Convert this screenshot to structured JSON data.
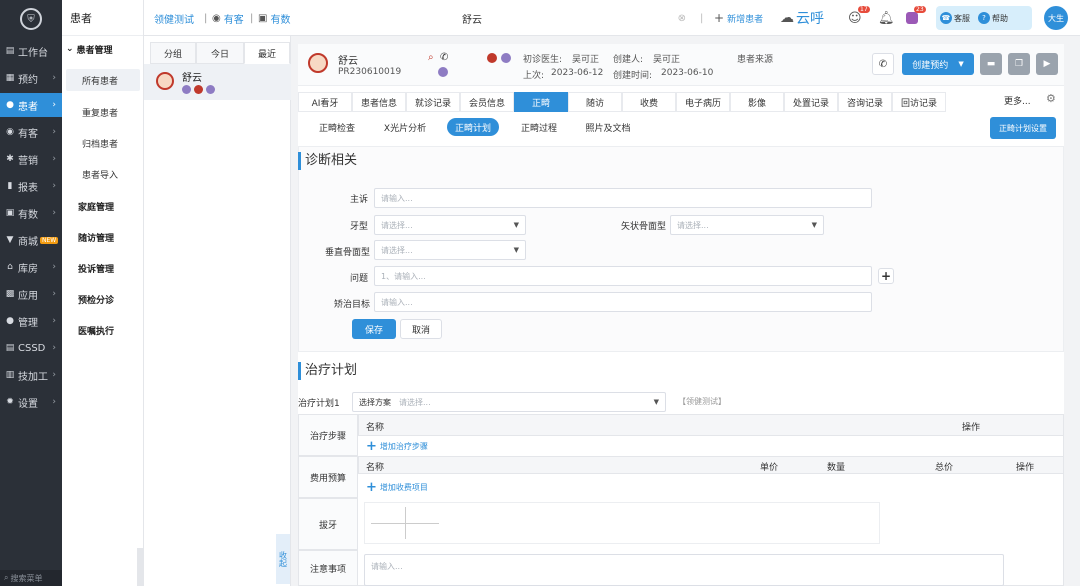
{
  "colors": {
    "accent": "#2f8fd9",
    "nav_bg": "#2b3038"
  },
  "nav": {
    "logo_icon": "tooth-shield-icon",
    "items": [
      {
        "label": "工作台",
        "icon": "dashboard-icon"
      },
      {
        "label": "预约",
        "icon": "calendar-icon"
      },
      {
        "label": "患者",
        "icon": "user-icon"
      },
      {
        "label": "有客",
        "icon": "eye-icon"
      },
      {
        "label": "营销",
        "icon": "gift-icon"
      },
      {
        "label": "报表",
        "icon": "chart-icon"
      },
      {
        "label": "有数",
        "icon": "data-icon"
      },
      {
        "label": "商城",
        "icon": "cart-icon",
        "badge": "NEW"
      },
      {
        "label": "库房",
        "icon": "warehouse-icon"
      },
      {
        "label": "应用",
        "icon": "apps-icon"
      },
      {
        "label": "管理",
        "icon": "manage-icon"
      },
      {
        "label": "CSSD",
        "icon": "cssd-icon"
      },
      {
        "label": "技加工",
        "icon": "tool-icon"
      },
      {
        "label": "设置",
        "icon": "gear-icon"
      }
    ],
    "bottom": "搜索菜单"
  },
  "submenu": {
    "title": "患者",
    "items": [
      {
        "label": "患者管理",
        "group": true
      },
      {
        "label": "所有患者"
      },
      {
        "label": "重复患者"
      },
      {
        "label": "归档患者"
      },
      {
        "label": "患者导入"
      },
      {
        "label": "家庭管理",
        "group": true
      },
      {
        "label": "随访管理",
        "group": true
      },
      {
        "label": "投诉管理",
        "group": true
      },
      {
        "label": "预检分诊",
        "group": true
      },
      {
        "label": "医嘱执行",
        "group": true
      }
    ]
  },
  "topbar": {
    "org": "领健测试",
    "sep": "|",
    "youke": "有客",
    "youshu": "有数",
    "search_value": "舒云",
    "new_patient": "新增患者",
    "yunhu": "云呼",
    "badge1": "17",
    "badge2": "23",
    "service": "客服",
    "help": "帮助",
    "user": "大生"
  },
  "plist": {
    "tabs": [
      "分组",
      "今日",
      "最近"
    ],
    "patient_name": "舒云",
    "collapse": "收起"
  },
  "patient": {
    "name": "舒云",
    "id": "PR230610019",
    "first_doctor_label": "初诊医生:",
    "first_doctor": "吴可正",
    "creator_label": "创建人:",
    "creator": "吴可正",
    "last_label": "上次:",
    "last_date": "2023-06-12",
    "created_label": "创建时间:",
    "created_date": "2023-06-10",
    "source_label": "患者来源",
    "create_appt": "创建预约"
  },
  "tabs": [
    "AI看牙",
    "患者信息",
    "就诊记录",
    "会员信息",
    "正畸",
    "随访",
    "收费",
    "电子病历",
    "影像",
    "处置记录",
    "咨询记录",
    "回访记录"
  ],
  "more": "更多...",
  "subtabs": [
    "正畸检查",
    "X光片分析",
    "正畸计划",
    "正畸过程",
    "照片及文档"
  ],
  "plan_settings": "正畸计划设置",
  "diagnosis": {
    "title": "诊断相关",
    "chief_label": "主诉",
    "chief_ph": "请输入...",
    "teeth_label": "牙型",
    "teeth_ph": "请选择...",
    "sagittal_label": "矢状骨面型",
    "sagittal_ph": "请选择...",
    "vertical_label": "垂直骨面型",
    "vertical_ph": "请选择...",
    "problem_label": "问题",
    "problem_ph": "1、请输入...",
    "goal_label": "矫治目标",
    "goal_ph": "请输入...",
    "save": "保存",
    "cancel": "取消"
  },
  "treatment": {
    "title": "治疗计划",
    "plan_label": "治疗计划1",
    "scheme_label": "选择方案",
    "scheme_ph": "请选择...",
    "tag": "【领健测试】",
    "steps_label": "治疗步骤",
    "col_name": "名称",
    "col_op": "操作",
    "add_step": "增加治疗步骤",
    "budget_label": "费用预算",
    "col_price": "单价",
    "col_qty": "数量",
    "col_total": "总价",
    "add_fee": "增加收费项目",
    "extract_label": "拔牙",
    "notes_label": "注意事项",
    "notes_ph": "请输入..."
  }
}
